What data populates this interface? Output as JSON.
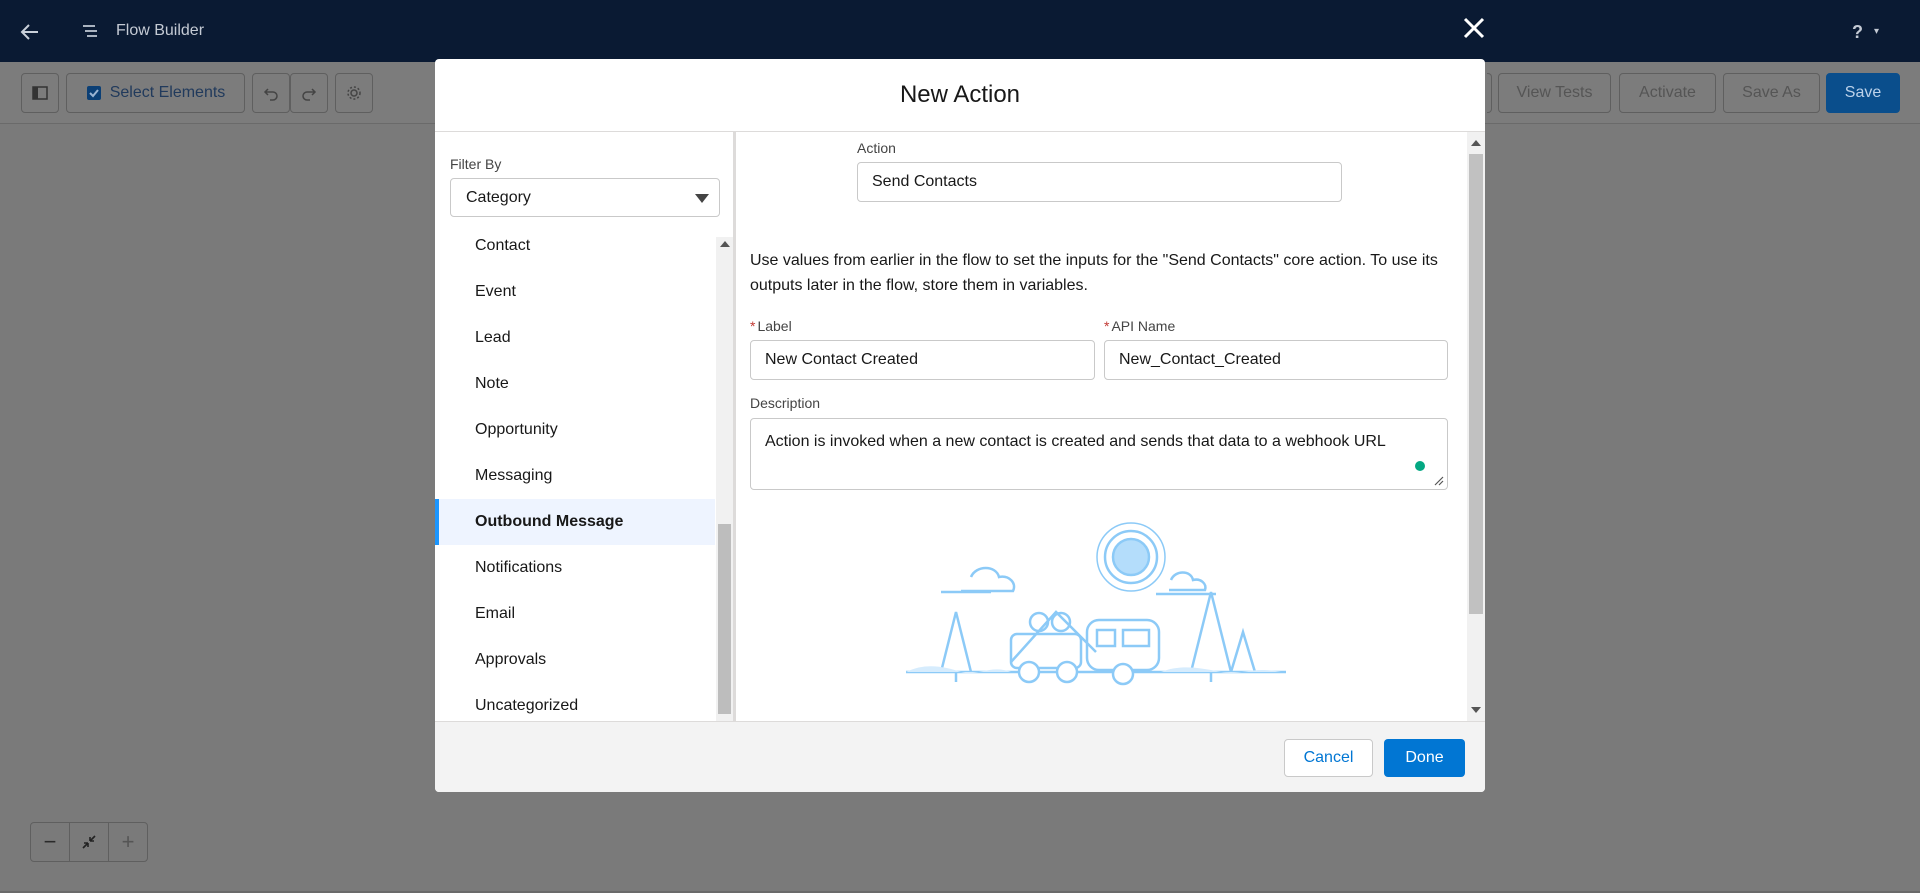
{
  "header": {
    "app_title": "Flow Builder",
    "help_label": "?",
    "back_icon": "back-arrow-icon",
    "app_icon": "flow-icon",
    "close_icon": "close-icon"
  },
  "toolbar": {
    "select_elements_label": "Select Elements",
    "view_tests_label": "View Tests",
    "activate_label": "Activate",
    "save_as_label": "Save As",
    "save_label": "Save"
  },
  "modal": {
    "title": "New Action",
    "filter": {
      "label": "Filter By",
      "selected": "Category"
    },
    "categories": [
      {
        "label": "Contact",
        "active": false
      },
      {
        "label": "Event",
        "active": false
      },
      {
        "label": "Lead",
        "active": false
      },
      {
        "label": "Note",
        "active": false
      },
      {
        "label": "Opportunity",
        "active": false
      },
      {
        "label": "Messaging",
        "active": false
      },
      {
        "label": "Outbound Message",
        "active": true
      },
      {
        "label": "Notifications",
        "active": false
      },
      {
        "label": "Email",
        "active": false
      },
      {
        "label": "Approvals",
        "active": false
      },
      {
        "label": "Uncategorized",
        "active": false
      }
    ],
    "action": {
      "label": "Action",
      "value": "Send Contacts"
    },
    "info_text": "Use values from earlier in the flow to set the inputs for the \"Send Contacts\" core action. To use its outputs later in the flow, store them in variables.",
    "label_field": {
      "required_mark": "*",
      "label": "Label",
      "value": "New Contact Created"
    },
    "api_name_field": {
      "required_mark": "*",
      "label": "API Name",
      "value": "New_Contact_Created"
    },
    "description_field": {
      "label": "Description",
      "value": "Action is invoked when a new contact is created and sends that data to a webhook URL"
    },
    "footer": {
      "cancel_label": "Cancel",
      "done_label": "Done"
    }
  },
  "zoom_controls": {
    "zoom_out": "−",
    "zoom_in": "+"
  },
  "colors": {
    "header_bg": "#0a1a33",
    "brand_blue": "#0176d3",
    "active_accent": "#1b96ff",
    "required_red": "#c23934"
  }
}
